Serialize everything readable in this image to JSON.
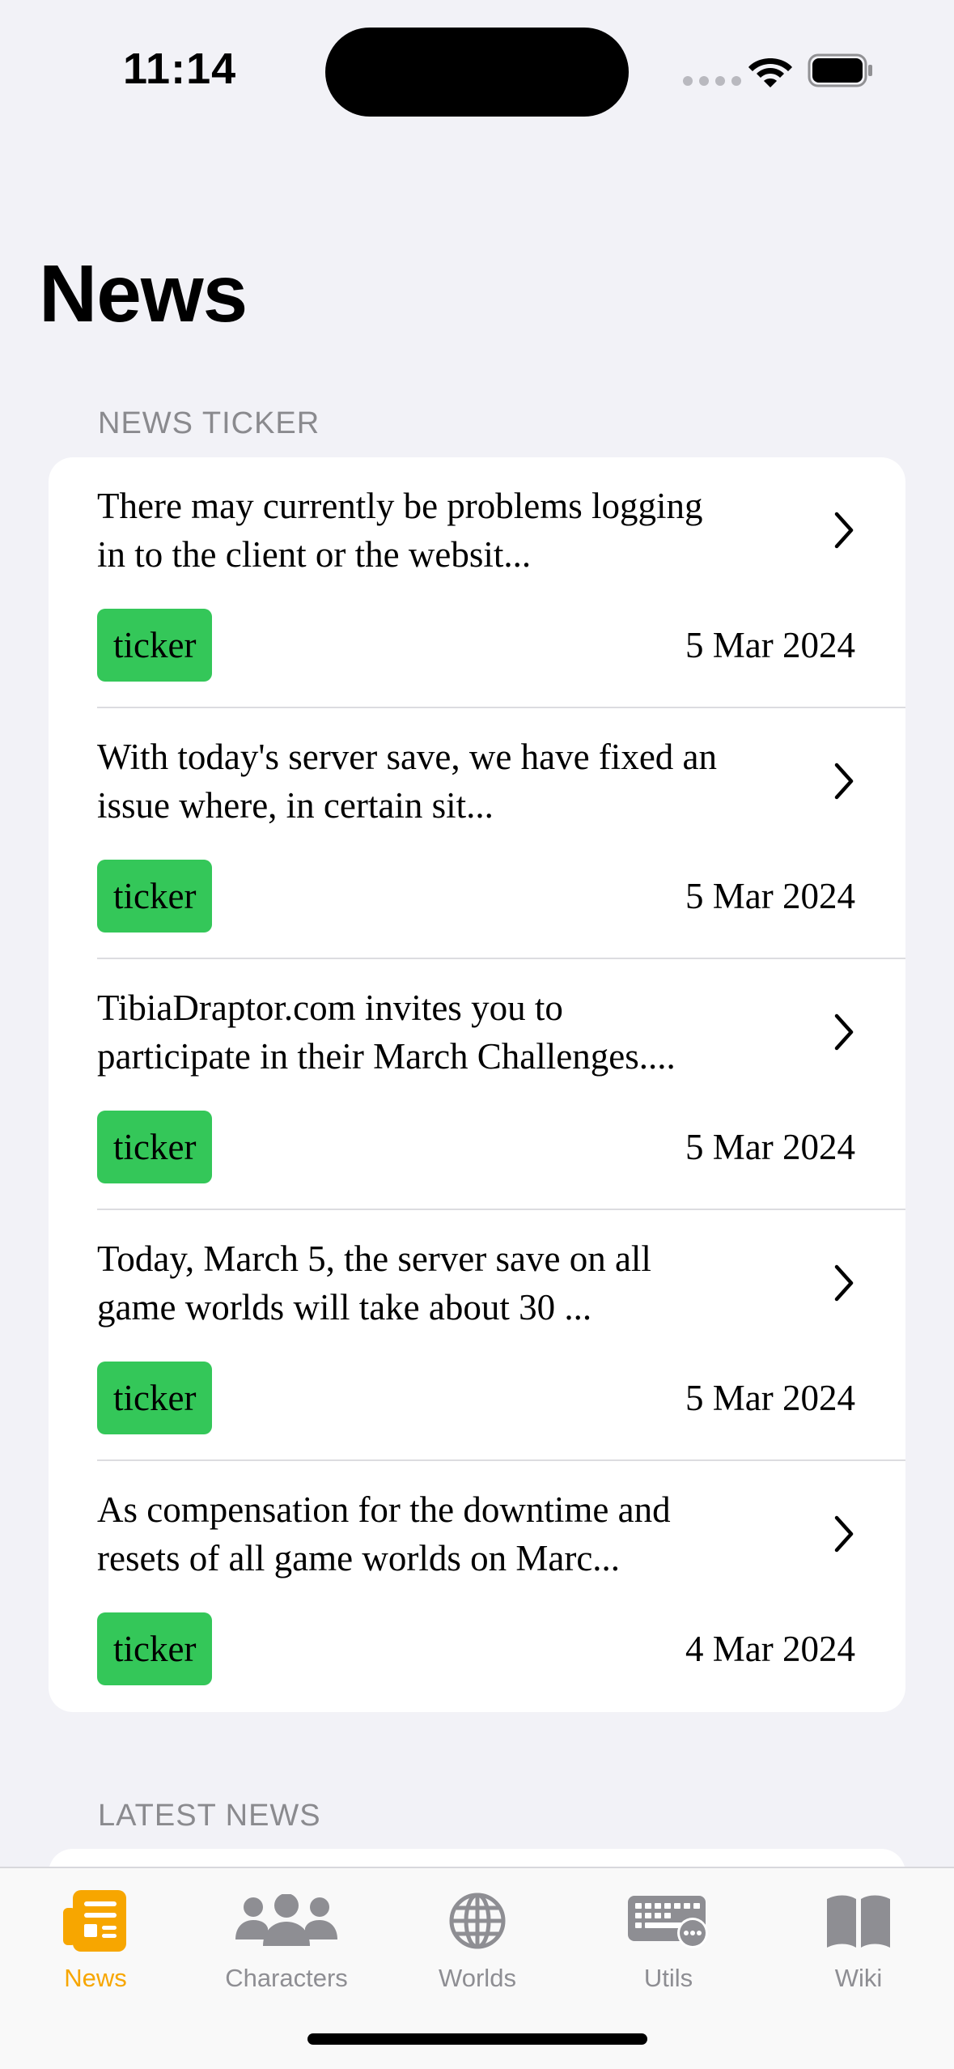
{
  "status_bar": {
    "time": "11:14"
  },
  "page": {
    "title": "News"
  },
  "sections": {
    "ticker_header": "NEWS TICKER",
    "latest_header": "LATEST NEWS"
  },
  "ticker_items": [
    {
      "line1": "There may currently be problems logging",
      "line2": "in to the client or the websit...",
      "tag": "ticker",
      "date": "5 Mar 2024"
    },
    {
      "line1": "With today's server save, we have fixed an",
      "line2": "issue where, in certain sit...",
      "tag": "ticker",
      "date": "5 Mar 2024"
    },
    {
      "line1": "TibiaDraptor.com invites you to",
      "line2": "participate in their March Challenges....",
      "tag": "ticker",
      "date": "5 Mar 2024"
    },
    {
      "line1": "Today, March 5, the server save on all",
      "line2": "game worlds will take about 30 ...",
      "tag": "ticker",
      "date": "5 Mar 2024"
    },
    {
      "line1": "As compensation for the downtime and",
      "line2": "resets of all game worlds on Marc...",
      "tag": "ticker",
      "date": "4 Mar 2024"
    }
  ],
  "tab_bar": {
    "items": [
      {
        "label": "News",
        "icon": "newspaper-icon",
        "active": true
      },
      {
        "label": "Characters",
        "icon": "people-icon",
        "active": false
      },
      {
        "label": "Worlds",
        "icon": "globe-icon",
        "active": false
      },
      {
        "label": "Utils",
        "icon": "keyboard-icon",
        "active": false
      },
      {
        "label": "Wiki",
        "icon": "book-icon",
        "active": false
      }
    ]
  },
  "colors": {
    "accent": "#f7a600",
    "tag_green": "#34c759",
    "inactive_gray": "#8e8e93",
    "background": "#f2f2f7"
  }
}
